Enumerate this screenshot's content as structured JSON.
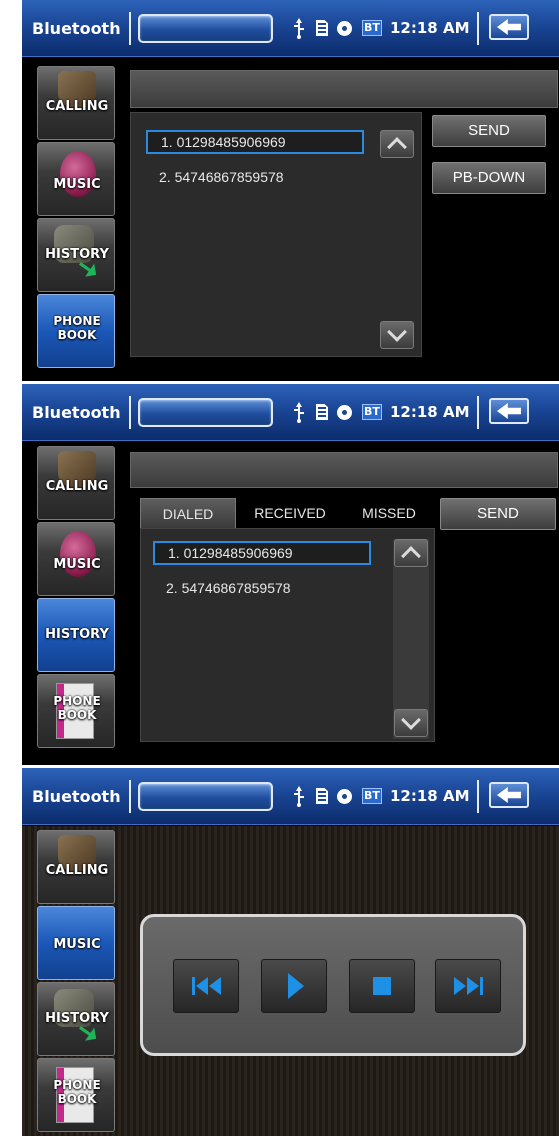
{
  "header": {
    "title": "Bluetooth",
    "bt_badge": "BT",
    "time": "12:18 AM",
    "icons": [
      "usb-icon",
      "sd-card-icon",
      "disc-icon",
      "bt-icon",
      "back-arrow-icon"
    ]
  },
  "menu": {
    "calling": "CALLING",
    "music": "MUSIC",
    "history": "HISTORY",
    "phone_book_1": "PHONE",
    "phone_book_2": "BOOK"
  },
  "phonebook_screen": {
    "active_menu": "PHONE BOOK",
    "entries": [
      "1. 01298485906969",
      "2. 54746867859578"
    ],
    "send_label": "SEND",
    "pb_down_label": "PB-DOWN"
  },
  "history_screen": {
    "active_menu": "HISTORY",
    "tabs": [
      "DIALED",
      "RECEIVED",
      "MISSED"
    ],
    "active_tab": "DIALED",
    "entries": [
      "1. 01298485906969",
      "2. 54746867859578"
    ],
    "send_label": "SEND"
  },
  "music_screen": {
    "active_menu": "MUSIC",
    "controls": [
      "previous-track-icon",
      "play-icon",
      "stop-icon",
      "next-track-icon"
    ]
  },
  "colors": {
    "header_blue": "#1a4696",
    "active_menu_blue": "#1b58b8",
    "selection_blue": "#2b8ae0",
    "player_icon_blue": "#1e90e6"
  }
}
